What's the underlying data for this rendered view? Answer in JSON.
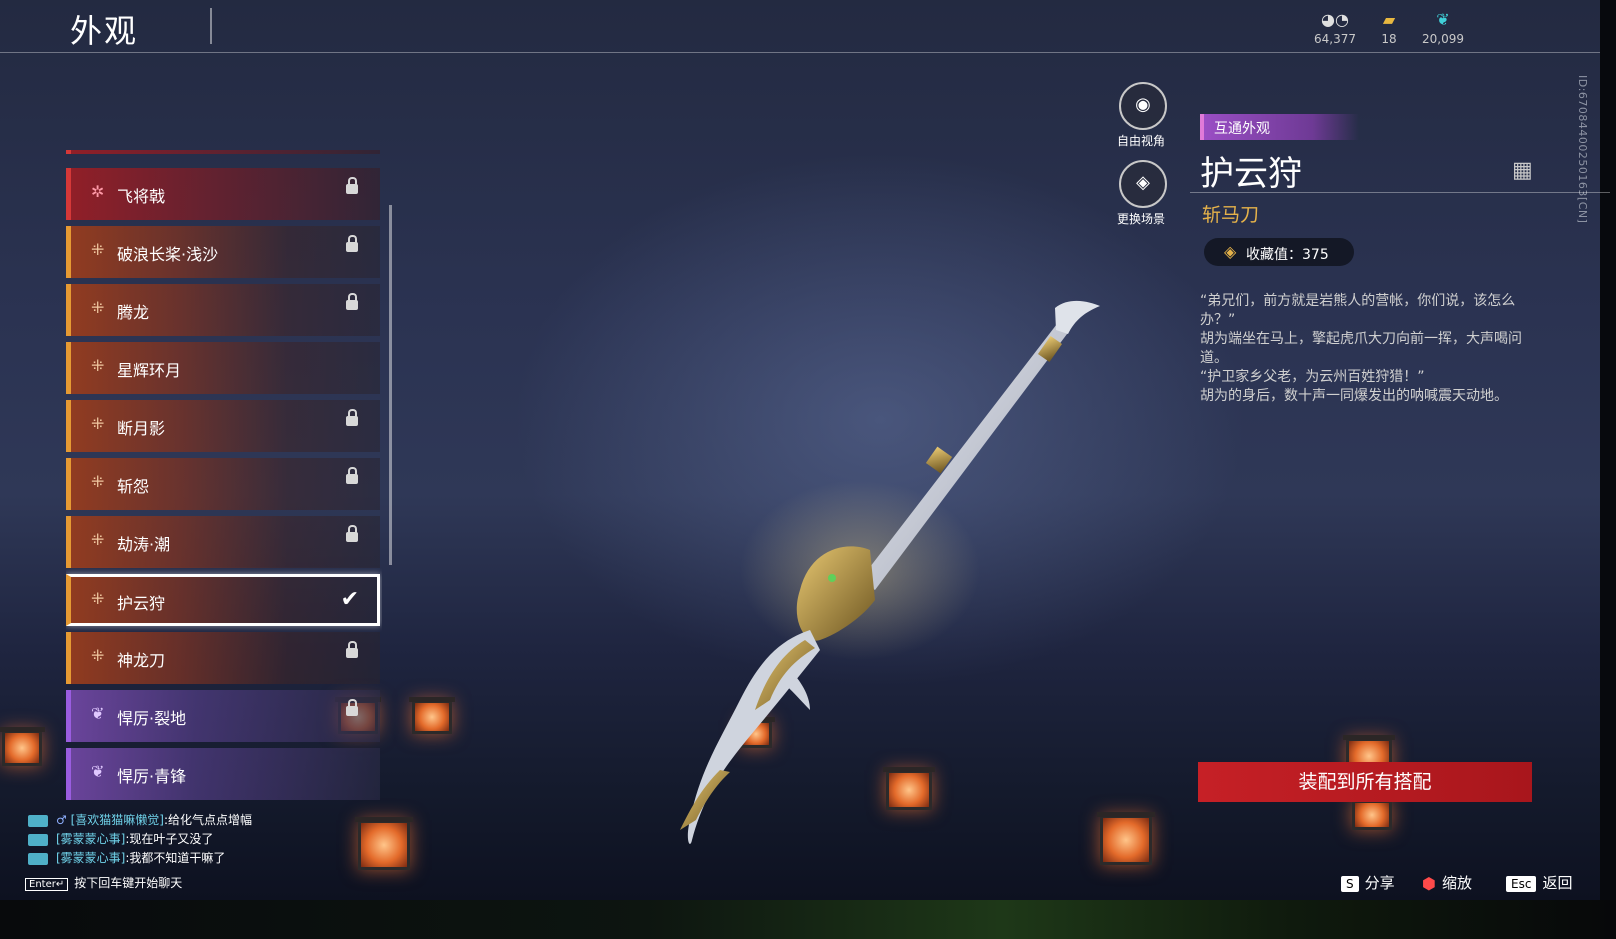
{
  "header": {
    "title": "外观",
    "currencies": [
      {
        "icon": "coin-stack-icon",
        "value": "64,377"
      },
      {
        "icon": "ticket-icon",
        "value": "18"
      },
      {
        "icon": "feather-icon",
        "value": "20,099"
      }
    ],
    "id_text": "ID:670844002501​63[CN]"
  },
  "list": {
    "items": [
      {
        "name": "飞将戟",
        "rarity": "red",
        "state": "locked"
      },
      {
        "name": "破浪长桨·浅沙",
        "rarity": "orange",
        "state": "locked"
      },
      {
        "name": "腾龙",
        "rarity": "orange",
        "state": "locked"
      },
      {
        "name": "星辉环月",
        "rarity": "orange",
        "state": "none"
      },
      {
        "name": "断月影",
        "rarity": "orange",
        "state": "locked"
      },
      {
        "name": "斩怨",
        "rarity": "orange",
        "state": "locked"
      },
      {
        "name": "劫涛·潮",
        "rarity": "orange",
        "state": "locked"
      },
      {
        "name": "护云狩",
        "rarity": "orange",
        "state": "selected"
      },
      {
        "name": "神龙刀",
        "rarity": "orange",
        "state": "locked"
      },
      {
        "name": "悍厉·裂地",
        "rarity": "purple",
        "state": "locked"
      },
      {
        "name": "悍厉·青锋",
        "rarity": "purple",
        "state": "none"
      }
    ]
  },
  "camera": {
    "free_view_label": "自由视角",
    "change_scene_label": "更换场景"
  },
  "detail": {
    "badge": "互通外观",
    "name": "护云狩",
    "type": "斩马刀",
    "collect_label": "收藏值：375",
    "lore": [
      "“弟兄们，前方就是岩熊人的营帐，你们说，该怎么办？”",
      "胡为端坐在马上，擎起虎爪大刀向前一挥，大声喝问道。",
      "“护卫家乡父老，为云州百姓狩猎！”",
      "胡为的身后，数十声一同爆发出的呐喊震天动地。"
    ],
    "equip_button": "装配到所有搭配"
  },
  "chat": {
    "messages": [
      {
        "who": "[喜欢猫猫嘛懒觉]",
        "text": ":给化气点点增幅"
      },
      {
        "who": "[雾蒙蒙心事]",
        "text": ":现在叶子又没了"
      },
      {
        "who": "[雾蒙蒙心事]",
        "text": ":我都不知道干嘛了"
      }
    ],
    "enter_key": "Enter↵",
    "hint": "按下回车键开始聊天"
  },
  "key_hints": {
    "share_key": "S",
    "share_label": "分享",
    "zoom_label": "缩放",
    "back_key": "Esc",
    "back_label": "返回"
  },
  "colors": {
    "accent_orange": "#e69a33",
    "accent_red": "#d53838",
    "accent_purple": "#9a5de0",
    "equip_red": "#c62026",
    "gold_text": "#e5b24a"
  }
}
